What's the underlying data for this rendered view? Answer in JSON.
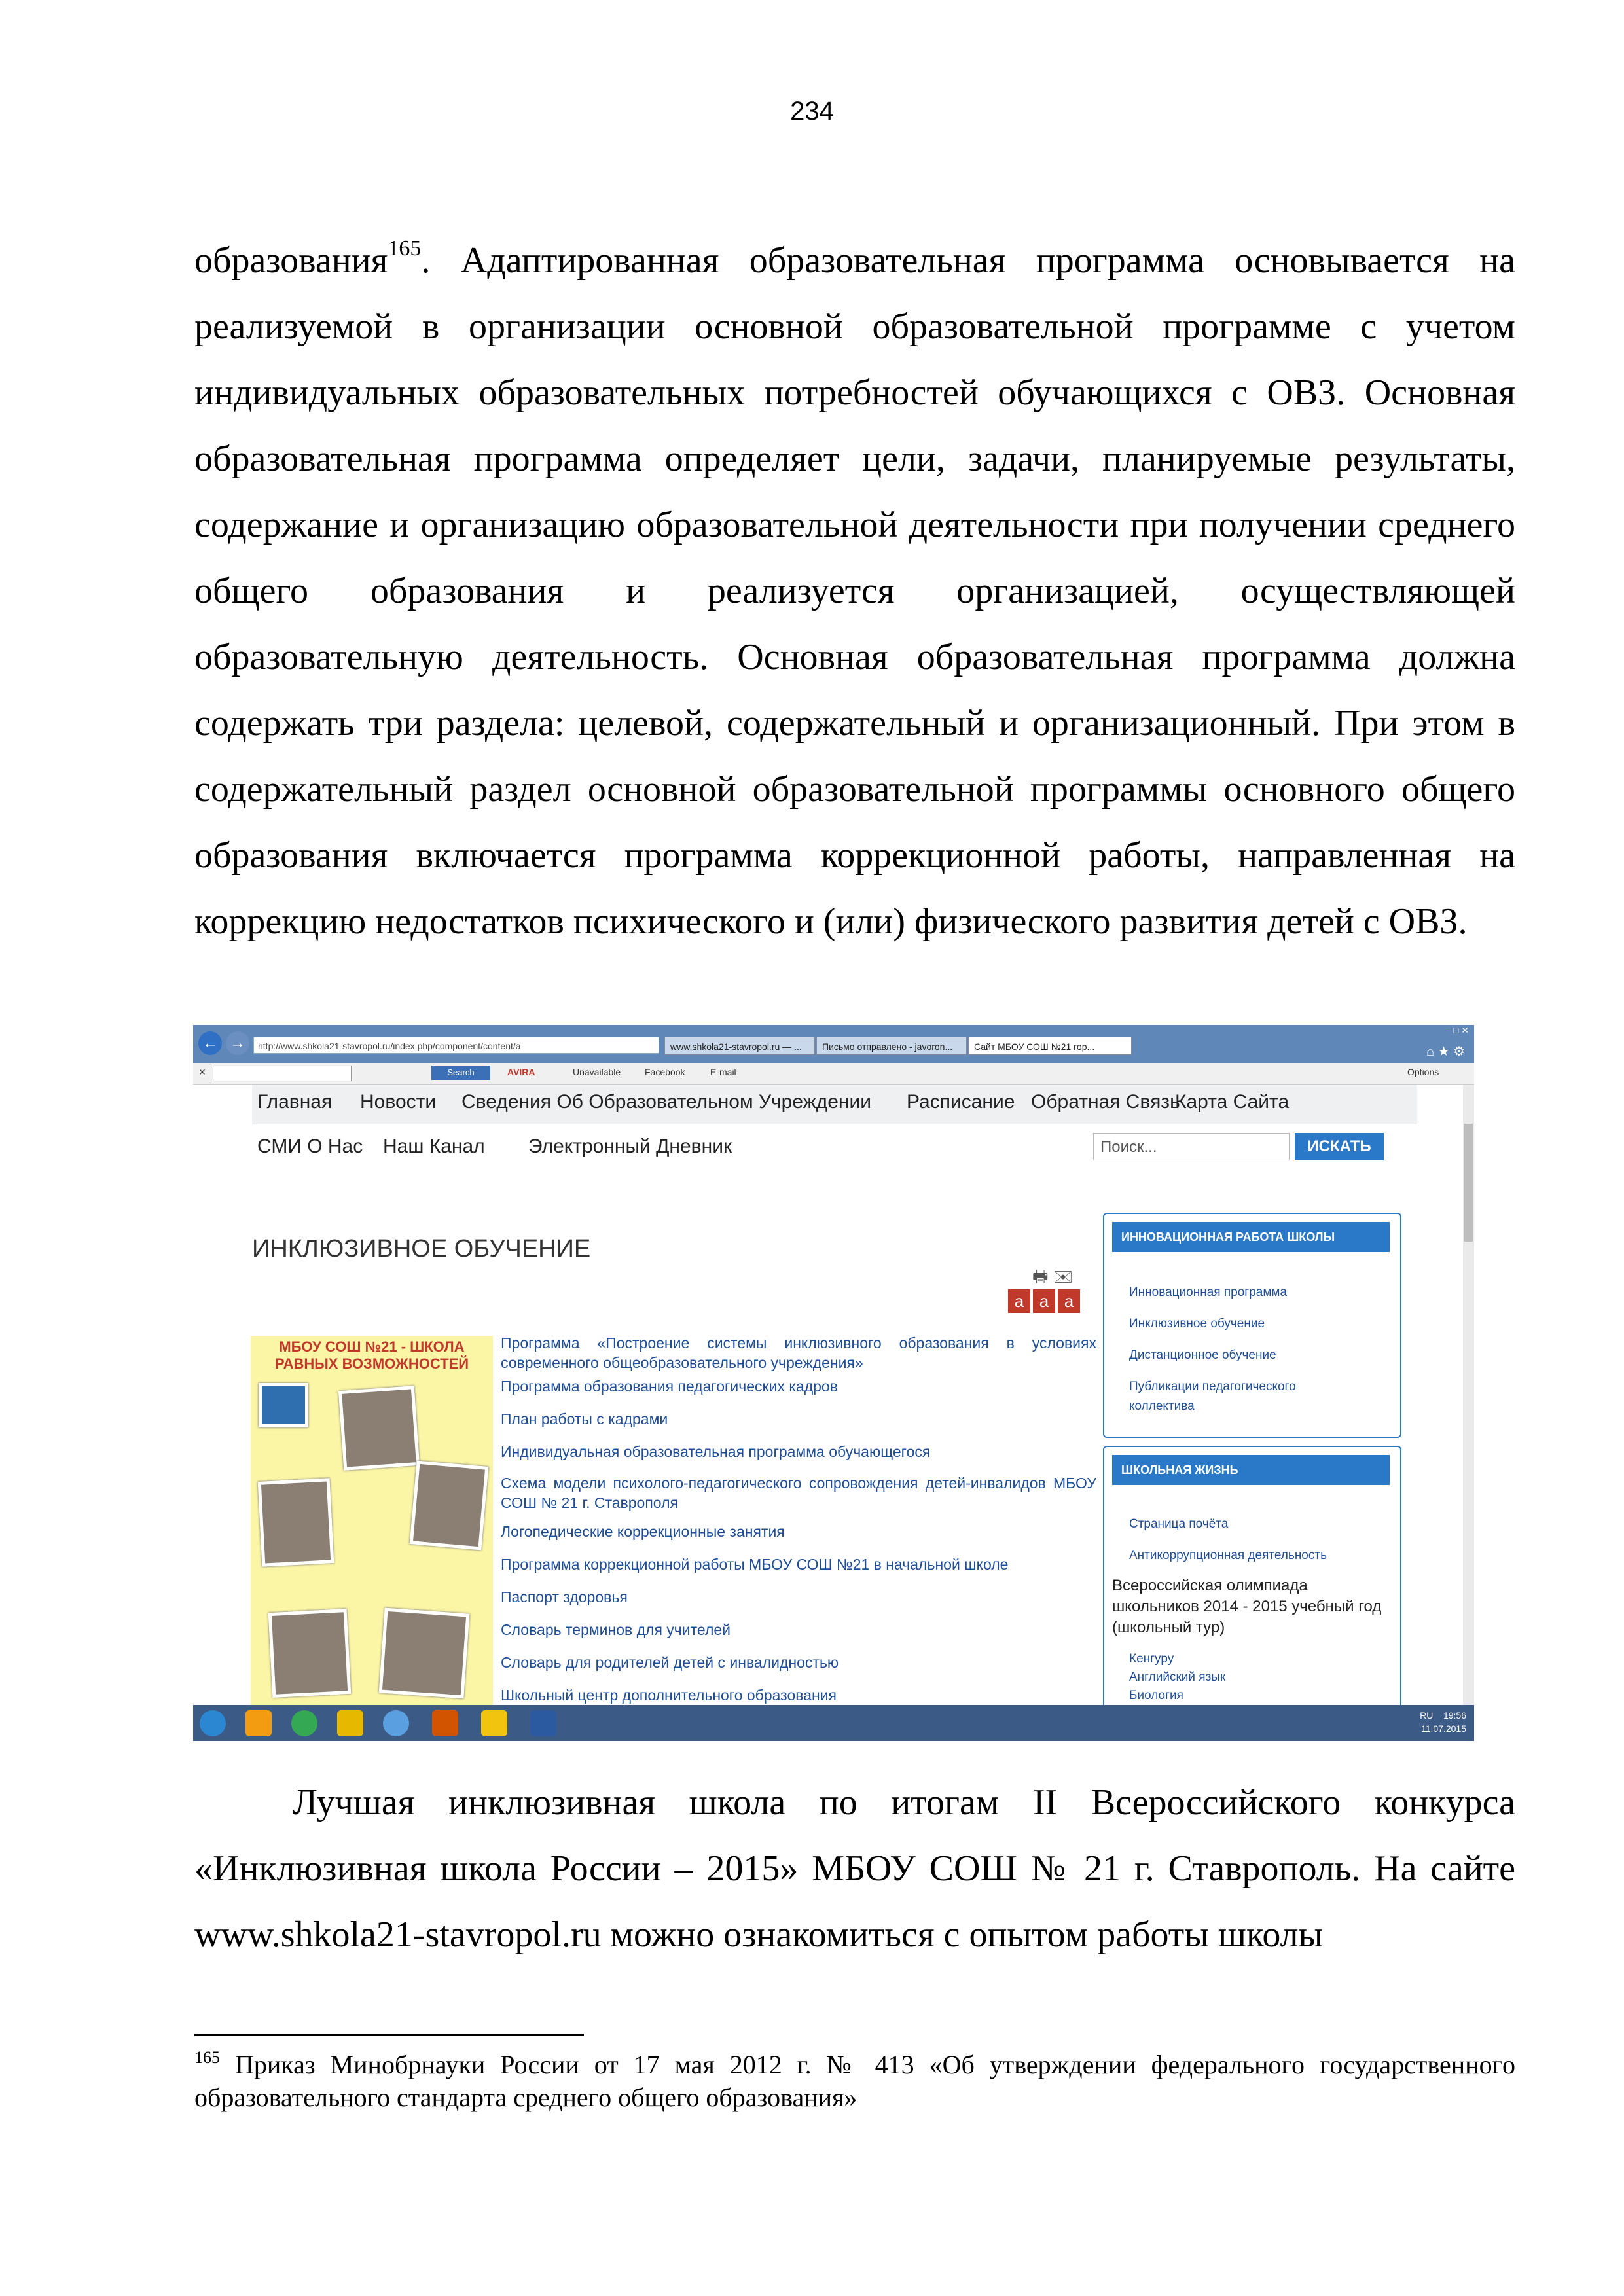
{
  "page_number": "234",
  "body_top": {
    "pre": "образования",
    "sup": "165",
    "text": ". Адаптированная образовательная программа основывается на реализуемой в организации основной образовательной программе с учетом индивидуальных образовательных потребностей обучающихся с ОВЗ. Основная образовательная программа определяет цели, задачи, планируемые результаты, содержание и организацию образовательной деятельности при получении среднего общего образования и реализуется организацией, осуществляющей образовательную деятельность. Основная образовательная программа должна содержать три раздела: целевой, содержательный и организационный. При этом в содержательный раздел основной образовательной программы основного общего образования включается программа коррекционной работы, направленная на коррекцию недостатков психического и (или) физического развития детей с ОВЗ."
  },
  "body_bottom": "Лучшая инклюзивная школа по итогам II Всероссийского конкурса «Инклюзивная школа России – 2015» МБОУ СОШ № 21 г. Ставрополь. На сайте  www.shkola21-stavropol.ru можно ознакомиться с опытом работы школы",
  "footnote": {
    "num": "165",
    "text": " Приказ Минобрнауки России от 17 мая 2012 г. № 413 «Об утверждении федерального государственного образовательного стандарта среднего общего образования»"
  },
  "screenshot": {
    "address": "http://www.shkola21-stavropol.ru/index.php/component/content/a",
    "tabs": [
      "www.shkola21-stavropol.ru — ...",
      "Письмо отправлено - javoron...",
      "Сайт МБОУ СОШ №21 гор..."
    ],
    "toolbar": {
      "search_btn": "Search",
      "avira": "AVIRA",
      "unavailable": "Unavailable",
      "facebook": "Facebook",
      "email": "E-mail",
      "options": "Options"
    },
    "menu_top": [
      "Главная",
      "Новости",
      "Сведения Об Образовательном Учреждении",
      "Расписание",
      "Обратная Связь",
      "Карта Сайта"
    ],
    "menu_second": [
      "СМИ О Нас",
      "Наш Канал",
      "Электронный Дневник"
    ],
    "search_placeholder": "Поиск...",
    "search_button": "ИСКАТЬ",
    "heading": "ИНКЛЮЗИВНОЕ ОБУЧЕНИЕ",
    "font_buttons": [
      "a",
      "a",
      "a"
    ],
    "poster_title": "МБОУ СОШ №21 - ШКОЛА РАВНЫХ ВОЗМОЖНОСТЕЙ",
    "links": [
      "Программа «Построение системы инклюзивного образования в условиях современного общеобразовательного учреждения»",
      "Программа образования педагогических кадров",
      "План работы с кадрами",
      "Индивидуальная образовательная программа обучающегося",
      "Схема модели психолого-педагогического сопровождения детей-инвалидов МБОУ СОШ № 21 г. Ставрополя",
      "Логопедические коррекционные занятия",
      "Программа коррекционной работы МБОУ СОШ №21 в начальной школе",
      "Паспорт здоровья",
      "Словарь терминов для учителей",
      "Словарь для родителей детей с инвалидностью",
      "Школьный центр дополнительного образования"
    ],
    "sidebar1": {
      "title": "ИННОВАЦИОННАЯ РАБОТА ШКОЛЫ",
      "items": [
        "Инновационная программа",
        "Инклюзивное обучение",
        "Дистанционное обучение",
        "Публикации педагогического",
        "коллектива"
      ]
    },
    "sidebar2": {
      "title": "ШКОЛЬНАЯ ЖИЗНЬ",
      "items": [
        "Страница почёта",
        "Антикоррупционная деятельность"
      ],
      "olymp": "Всероссийская олимпиада школьников 2014 - 2015 учебный год (школьный тур)",
      "items2": [
        "Кенгуру",
        "Английский язык",
        "Биология"
      ]
    },
    "tray": {
      "lang": "RU",
      "time": "19:56",
      "date": "11.07.2015"
    }
  }
}
